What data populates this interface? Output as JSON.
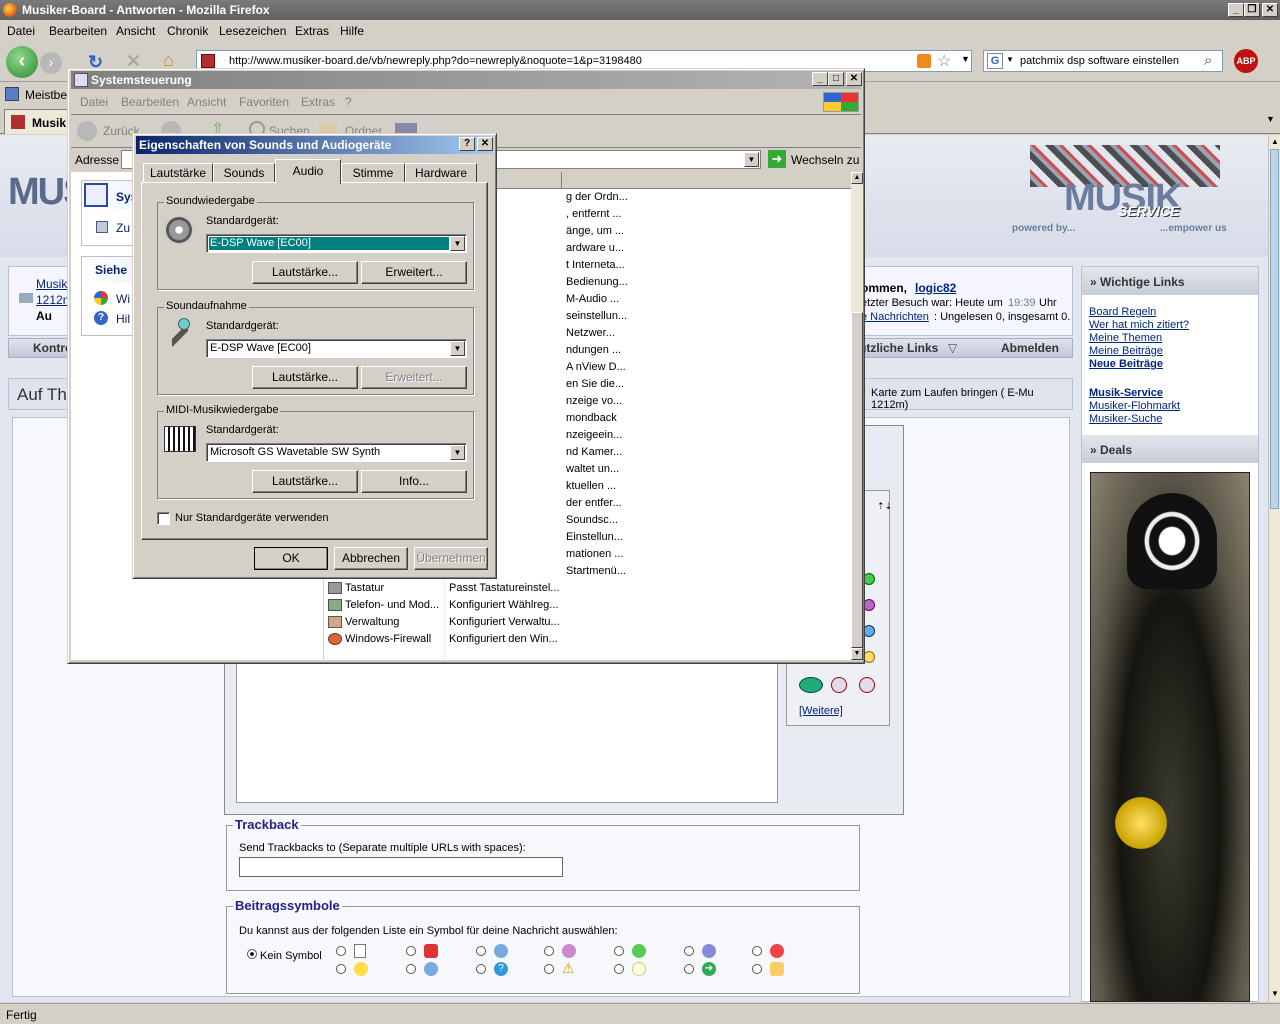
{
  "firefox": {
    "title": "Musiker-Board - Antworten - Mozilla Firefox",
    "menu": [
      "Datei",
      "Bearbeiten",
      "Ansicht",
      "Chronik",
      "Lesezeichen",
      "Extras",
      "Hilfe"
    ],
    "url": "http://www.musiker-board.de/vb/newreply.php?do=newreply&noquote=1&p=3198480",
    "search_value": "patchmix dsp software einstellen",
    "bookmark": "Meistbes",
    "tab": "Musik",
    "status": "Fertig",
    "abp": "ABP"
  },
  "page": {
    "logo_left": "MUS",
    "logo_right": "MUSIK",
    "logo_script": "SERVICE",
    "powered": "powered by...",
    "empower": "...empower us",
    "breadcrumb": [
      "Musik",
      "1212n",
      "Au"
    ],
    "welcome_tail": "ommen,",
    "user": "logic82",
    "last_visit": "etzter Besuch war: Heute um",
    "time": "19:39",
    "uhr": "Uhr",
    "messages_link": "e Nachrichten",
    "messages_rest": ": Ungelesen 0, insgesamt 0.",
    "nav_left": "Kontro",
    "nav_useful": "ützliche Links",
    "nav_logout": "Abmelden",
    "thread_title_part": "Auf Th",
    "thread_right": "Karte zum Laufen bringen ( E-Mu 1212m)",
    "links_header": "» Wichtige Links",
    "links": [
      "Board Regeln",
      "Wer hat mich zitiert?",
      "Meine Themen",
      "Meine Beiträge",
      "Neue Beiträge"
    ],
    "links2": [
      "Musik-Service",
      "Musiker-Flohmarkt",
      "Musiker-Suche"
    ],
    "deals_header": "» Deals",
    "more_smilies": "[Weitere]",
    "trackback_legend": "Trackback",
    "trackback_label": "Send Trackbacks to (Separate multiple URLs with spaces):",
    "symbols_legend": "Beitragssymbole",
    "symbols_label": "Du kannst aus der folgenden Liste ein Symbol für deine Nachricht auswählen:",
    "no_symbol": "Kein Symbol"
  },
  "cp": {
    "title": "Systemsteuerung",
    "menu": [
      "Datei",
      "Bearbeiten",
      "Ansicht",
      "Favoriten",
      "Extras",
      "?"
    ],
    "back": "Zurück",
    "search": "Suchen",
    "folders": "Ordner",
    "address": "Adresse",
    "go": "Wechseln zu",
    "side_a": "Sys",
    "side_b": "Zu",
    "side_see": "Siehe",
    "side_c": "Wi",
    "side_d": "Hil",
    "col_header": "e",
    "descs": [
      "g der Ordn...",
      ", entfernt ...",
      "änge, um ...",
      "ardware u...",
      "t Interneta...",
      "Bedienung...",
      "M-Audio ...",
      "seinstellun...",
      "Netzwer...",
      "ndungen ...",
      "A nView D...",
      "en Sie die...",
      "nzeige vo...",
      "mondback",
      "nzeigeein...",
      "nd Kamer...",
      "waltet un...",
      "ktuellen ...",
      "der entfer...",
      "Soundsc...",
      "Einstellun...",
      "mationen ...",
      "Startmenü..."
    ],
    "items": [
      {
        "name": "Tastatur",
        "desc": "Passt Tastatureinstel..."
      },
      {
        "name": "Telefon- und Mod...",
        "desc": "Konfiguriert Wählreg..."
      },
      {
        "name": "Verwaltung",
        "desc": "Konfiguriert Verwaltu..."
      },
      {
        "name": "Windows-Firewall",
        "desc": "Konfiguriert den Win..."
      }
    ]
  },
  "dlg": {
    "title": "Eigenschaften von Sounds und Audiogeräte",
    "help": "?",
    "close": "✕",
    "tabs": [
      "Lautstärke",
      "Sounds",
      "Audio",
      "Stimme",
      "Hardware"
    ],
    "playback": {
      "legend": "Soundwiedergabe",
      "label": "Standardgerät:",
      "value": "E-DSP Wave [EC00]",
      "vol": "Lautstärke...",
      "adv": "Erweitert..."
    },
    "record": {
      "legend": "Soundaufnahme",
      "label": "Standardgerät:",
      "value": "E-DSP Wave [EC00]",
      "vol": "Lautstärke...",
      "adv": "Erweitert..."
    },
    "midi": {
      "legend": "MIDI-Musikwiedergabe",
      "label": "Standardgerät:",
      "value": "Microsoft GS Wavetable SW Synth",
      "vol": "Lautstärke...",
      "info": "Info..."
    },
    "only_default": "Nur Standardgeräte verwenden",
    "ok": "OK",
    "cancel": "Abbrechen",
    "apply": "Übernehmen"
  },
  "colors": {
    "accent": "#0a246a",
    "title_active": "#0a246a",
    "selected": "#008080",
    "inactive_title": "#808080"
  }
}
